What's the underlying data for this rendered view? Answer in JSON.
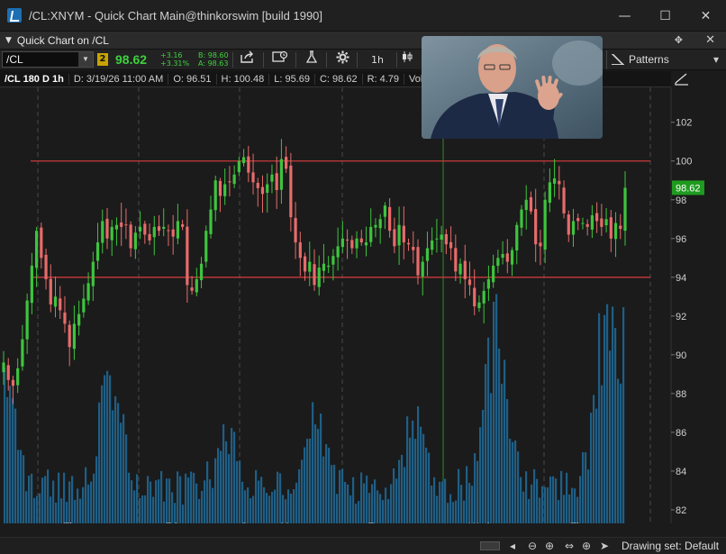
{
  "window": {
    "title": "/CL:XNYM - Quick Chart Main@thinkorswim [build 1990]",
    "minimize": "—",
    "maximize": "☐",
    "close": "✕"
  },
  "panel": {
    "title": "Quick Chart on /CL",
    "pin": "✥",
    "close": "✕"
  },
  "toolbar": {
    "symbol": "/CL",
    "link_number": "2",
    "last_price": "98.62",
    "net_change": "+3.16",
    "pct_change": "+3.31%",
    "bid": "B: 98.60",
    "ask": "A: 98.63",
    "aggregation": "1h",
    "patterns_label": "Patterns",
    "icons": [
      "share-icon",
      "snapshot-icon",
      "studies-flask-icon",
      "gear-icon",
      "drawing-tools-icon"
    ]
  },
  "info_bar": {
    "symbol_period": "/CL 180 D 1h",
    "date": "D: 3/19/26 11:00 AM",
    "open": "O: 96.51",
    "high": "H: 100.48",
    "low": "L: 95.69",
    "close": "C: 98.62",
    "range": "R: 4.79",
    "volume": "Volum"
  },
  "colors": {
    "bull": "#3ec43e",
    "bear": "#e86b6b",
    "volume": "#1f5f86",
    "resistance": "#c93a3a",
    "price_tag": "#1f9b1f"
  },
  "chart_data": {
    "type": "candlestick",
    "y_ticks": [
      "82",
      "84",
      "86",
      "88",
      "90",
      "92",
      "94",
      "96",
      "98",
      "100",
      "102"
    ],
    "ylim": [
      81.3,
      103.8
    ],
    "x_labels": [
      "Thu",
      "Fri",
      "Sun",
      "Mon",
      "Tue",
      "Wed",
      "Thu"
    ],
    "current_price_tag": "98.62",
    "horizontal_lines": [
      100.0,
      94.0
    ],
    "series": [
      {
        "name": "price",
        "close_path": [
          89.6,
          88.7,
          88.4,
          89.3,
          90.8,
          92.8,
          94.6,
          96.4,
          95.0,
          93.9,
          92.6,
          93.0,
          92.3,
          91.6,
          90.4,
          91.6,
          92.1,
          92.9,
          93.7,
          94.8,
          95.8,
          96.9,
          96.0,
          96.6,
          96.7,
          96.6,
          96.7,
          95.5,
          96.3,
          96.6,
          96.2,
          95.9,
          96.6,
          96.4,
          96.6,
          96.4,
          96.1,
          96.9,
          96.6,
          93.6,
          93.3,
          93.9,
          94.7,
          96.4,
          97.5,
          99.0,
          98.2,
          98.8,
          98.9,
          99.3,
          100.0,
          100.2,
          99.4,
          98.9,
          98.6,
          98.3,
          98.8,
          99.3,
          98.5,
          100.1,
          99.6,
          97.1,
          95.8,
          95.0,
          94.3,
          94.8,
          93.6,
          94.5,
          94.7,
          94.6,
          95.1,
          95.6,
          96.0,
          95.9,
          95.5,
          96.0,
          95.8,
          95.8,
          96.6,
          96.7,
          97.0,
          97.7,
          96.4,
          95.6,
          96.7,
          95.8,
          95.7,
          95.4,
          94.1,
          94.8,
          95.5,
          95.9,
          96.0,
          96.2,
          95.7,
          95.5,
          94.3,
          94.7,
          93.9,
          93.6,
          92.5,
          92.7,
          93.3,
          93.9,
          94.6,
          95.0,
          95.2,
          94.8,
          95.4,
          96.7,
          97.5,
          98.0,
          97.4,
          95.7,
          95.6,
          98.0,
          98.9,
          99.1,
          98.8,
          97.3,
          96.2,
          96.9,
          96.9,
          96.8,
          96.6,
          97.2,
          96.9,
          96.6,
          97.0,
          96.0,
          96.8,
          96.5,
          98.62
        ]
      },
      {
        "name": "volume",
        "relative": "bars at bottom of chart"
      }
    ]
  },
  "video_overlay": {
    "shows": "picture-in-picture video of a speaker"
  },
  "status_bar": {
    "drawing_set": "Drawing set: Default",
    "icons": [
      "zoom-out-icon",
      "zoom-in-icon",
      "pan-icon",
      "crosshair-icon",
      "cursor-icon"
    ]
  }
}
